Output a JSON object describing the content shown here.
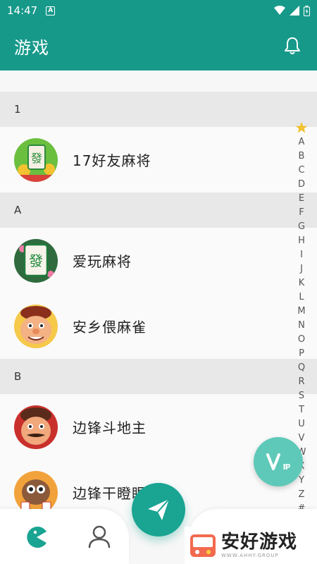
{
  "status_bar": {
    "time": "14:47",
    "notif_letter": "A"
  },
  "app_bar": {
    "title": "游戏"
  },
  "sections": [
    {
      "letter": "1",
      "items": [
        {
          "name": "17好友麻将",
          "icon": "mahjong-fa-icon"
        }
      ]
    },
    {
      "letter": "A",
      "items": [
        {
          "name": "爱玩麻将",
          "icon": "mahjong-fa-icon"
        },
        {
          "name": "安乡偎麻雀",
          "icon": "cartoon-face-icon"
        }
      ]
    },
    {
      "letter": "B",
      "items": [
        {
          "name": "边锋斗地主",
          "icon": "cartoon-face-icon"
        },
        {
          "name": "边锋干瞪眼",
          "icon": "cartoon-face-icon"
        }
      ]
    }
  ],
  "index_bar": [
    "A",
    "B",
    "C",
    "D",
    "E",
    "F",
    "G",
    "H",
    "I",
    "J",
    "K",
    "L",
    "M",
    "N",
    "O",
    "P",
    "Q",
    "R",
    "S",
    "T",
    "U",
    "V",
    "W",
    "X",
    "Y",
    "Z",
    "#"
  ],
  "vip_label": "VIP",
  "watermark": {
    "main": "安好游戏",
    "sub": "WWW.AHHY.GROUP"
  },
  "colors": {
    "primary": "#17998a",
    "fab": "#1aa492",
    "vip": "#5ec9b8"
  }
}
